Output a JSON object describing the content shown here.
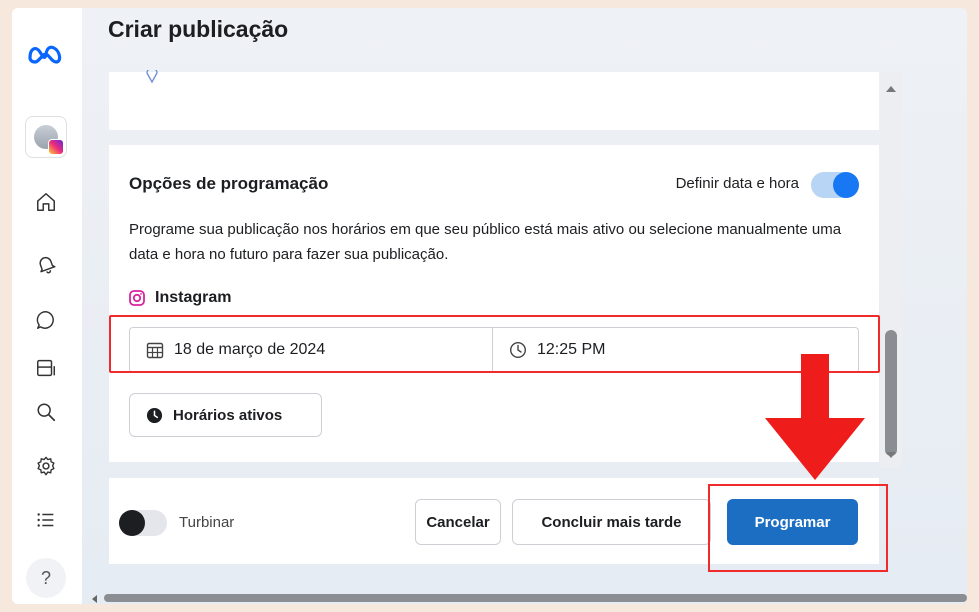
{
  "page": {
    "title": "Criar publicação"
  },
  "sidebar": {
    "logo": "meta-logo",
    "items": [
      {
        "name": "home",
        "icon": "home-icon"
      },
      {
        "name": "notifications",
        "icon": "bell-icon"
      },
      {
        "name": "messages",
        "icon": "chat-icon"
      },
      {
        "name": "content",
        "icon": "panel-icon"
      },
      {
        "name": "search",
        "icon": "search-icon"
      },
      {
        "name": "settings",
        "icon": "gear-icon"
      },
      {
        "name": "menu",
        "icon": "list-icon"
      }
    ],
    "help_label": "?"
  },
  "scheduling": {
    "title": "Opções de programação",
    "toggle_label": "Definir data e hora",
    "toggle_on": true,
    "description": "Programe sua publicação nos horários em que seu público está mais ativo ou selecione manualmente uma data e hora no futuro para fazer sua publicação.",
    "platform": "Instagram",
    "date": "18 de março de 2024",
    "time": "12:25 PM",
    "active_times_button": "Horários ativos"
  },
  "footer": {
    "boost_label": "Turbinar",
    "boost_on": false,
    "cancel_label": "Cancelar",
    "later_label": "Concluir mais tarde",
    "schedule_label": "Programar"
  },
  "colors": {
    "accent": "#1877f2",
    "primary_button": "#1b6ec2",
    "highlight": "#ef2b2b",
    "background": "#f6e8dd"
  }
}
